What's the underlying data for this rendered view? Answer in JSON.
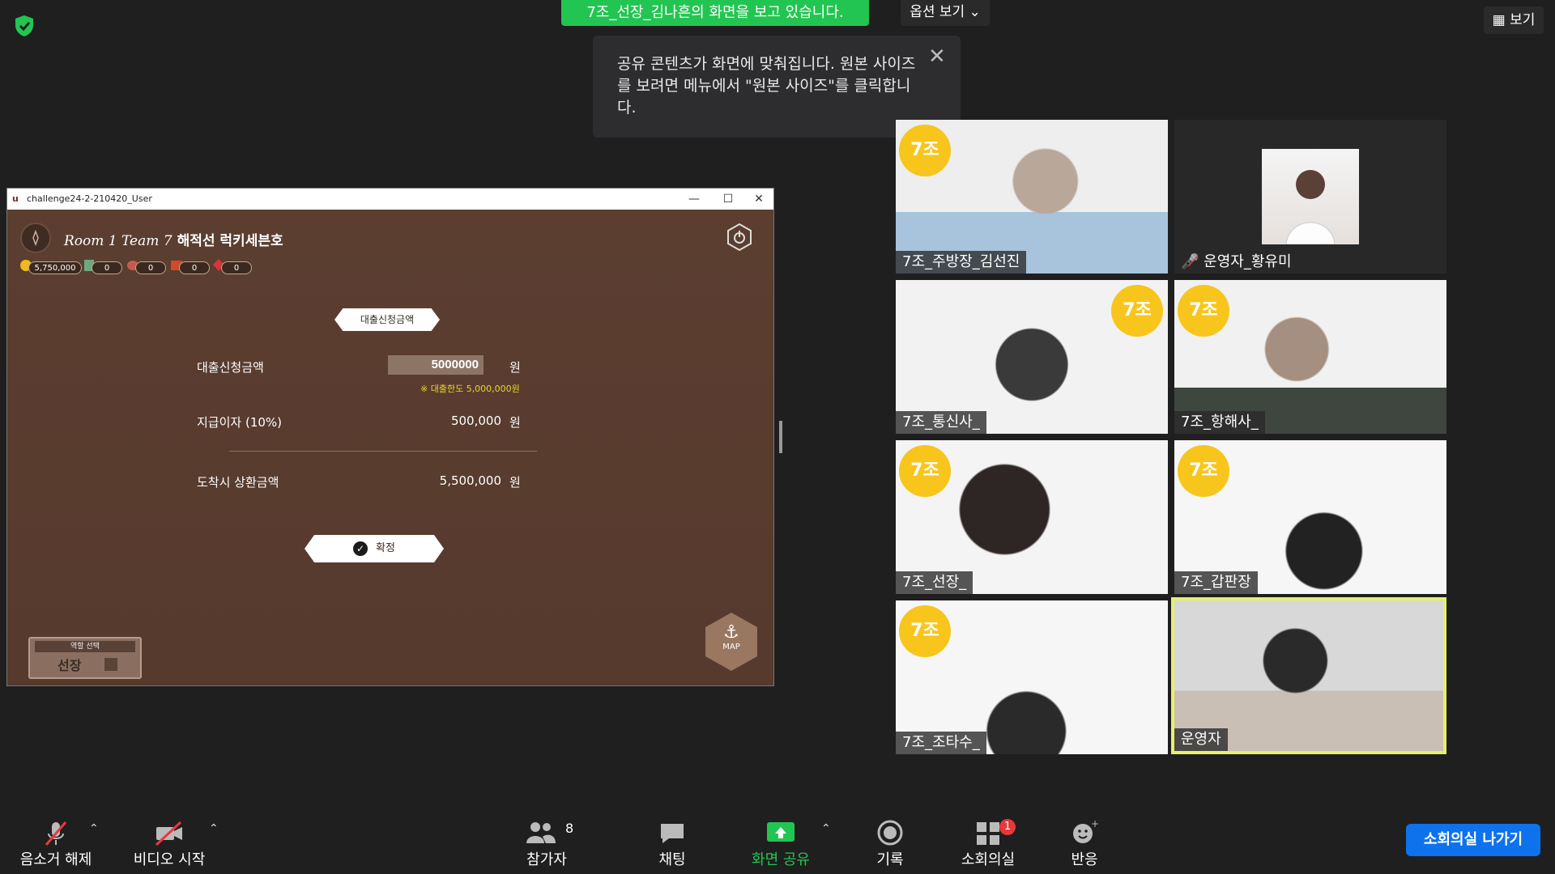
{
  "banner": {
    "sharing_text": "7조_선장_김나흔의 화면을 보고 있습니다.",
    "options_label": "옵션 보기 ⌄",
    "view_label": "보기"
  },
  "tooltip": {
    "text": "공유 콘텐츠가 화면에 맞춰집니다. 원본 사이즈를 보려면 메뉴에서 \"원본 사이즈\"를 클릭합니다."
  },
  "app_window": {
    "title": "challenge24-2-210420_User",
    "room_prefix": "Room 1  Team 7",
    "ship_name": "해적선 럭키세븐호",
    "resources": [
      "5,750,000",
      "0",
      "0",
      "0",
      "0"
    ],
    "loan_tag": "대출신청금액",
    "loan_label": "대출신청금액",
    "loan_value": "5000000",
    "loan_unit": "원",
    "loan_limit": "※ 대출한도 5,000,000원",
    "interest_label": "지급이자  (10%)",
    "interest_value": "500,000",
    "interest_unit": "원",
    "repay_label": "도착시 상환금액",
    "repay_value": "5,500,000",
    "repay_unit": "원",
    "confirm_label": "확정",
    "role_header": "역할 선택",
    "role_value": "선장",
    "map_label": "MAP"
  },
  "participants": [
    {
      "name": "7조_주방장_김선진",
      "badge": "7조"
    },
    {
      "name": "운영자_황유미",
      "badge": ""
    },
    {
      "name": "7조_통신사_",
      "badge": "7조"
    },
    {
      "name": "7조_항해사_",
      "badge": "7조"
    },
    {
      "name": "7조_선장_",
      "badge": "7조"
    },
    {
      "name": "7조_갑판장",
      "badge": "7조"
    },
    {
      "name": "7조_조타수_",
      "badge": "7조"
    },
    {
      "name": "운영자",
      "badge": ""
    }
  ],
  "toolbar": {
    "mute": "음소거 해제",
    "video": "비디오 시작",
    "participants": "참가자",
    "participants_count": "8",
    "chat": "채팅",
    "share": "화면 공유",
    "record": "기록",
    "breakout": "소회의실",
    "breakout_badge": "1",
    "reactions": "반응",
    "leave": "소회의실 나가기"
  },
  "colors": {
    "share_green": "#23c552",
    "badge_yellow": "#f8c51c",
    "leave_blue": "#0e72ed",
    "active_speaker": "#e6f06a"
  }
}
